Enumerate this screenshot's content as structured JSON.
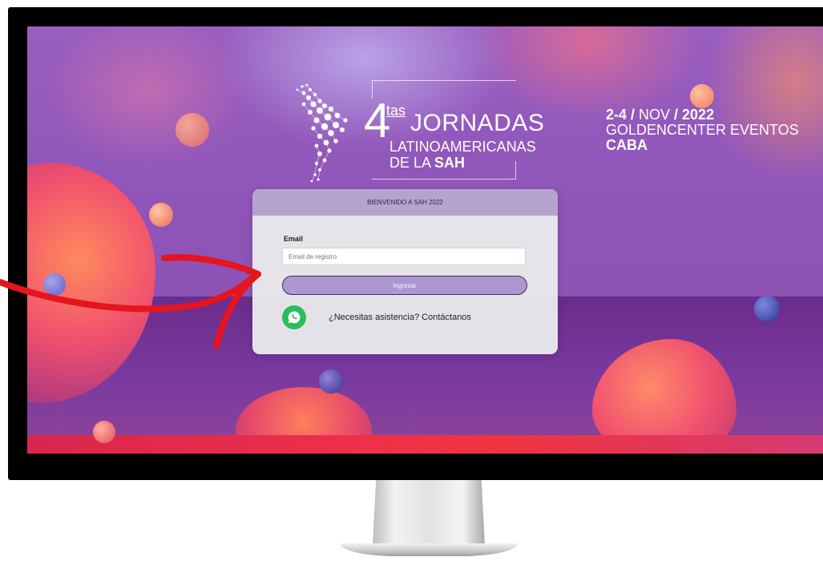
{
  "event": {
    "number": "4",
    "ordinal": "tas",
    "title_line1": "JORNADAS",
    "title_line2": "LATINOAMERICANAS",
    "title_line3_prefix": "DE LA ",
    "title_line3_bold": "SAH",
    "dates_bold": "2-4 /",
    "dates_month": " NOV ",
    "dates_year": "/ 2022",
    "venue": "GOLDENCENTER EVENTOS",
    "city": "CABA"
  },
  "login": {
    "header": "BIENVENIDO A  SAH 2022",
    "email_label": "Email",
    "email_placeholder": "Email de registro",
    "email_value": "",
    "submit_label": "Ingresar",
    "help_text": "¿Necesitas asistencia? Contáctanos"
  },
  "icons": {
    "help": "whatsapp-icon",
    "logo": "south-america-map-icon",
    "annotation": "red-arrow"
  },
  "colors": {
    "card_header": "#b7a3cf",
    "button": "#ad97d1",
    "whatsapp": "#2bbd5b",
    "arrow": "#e5141f"
  }
}
